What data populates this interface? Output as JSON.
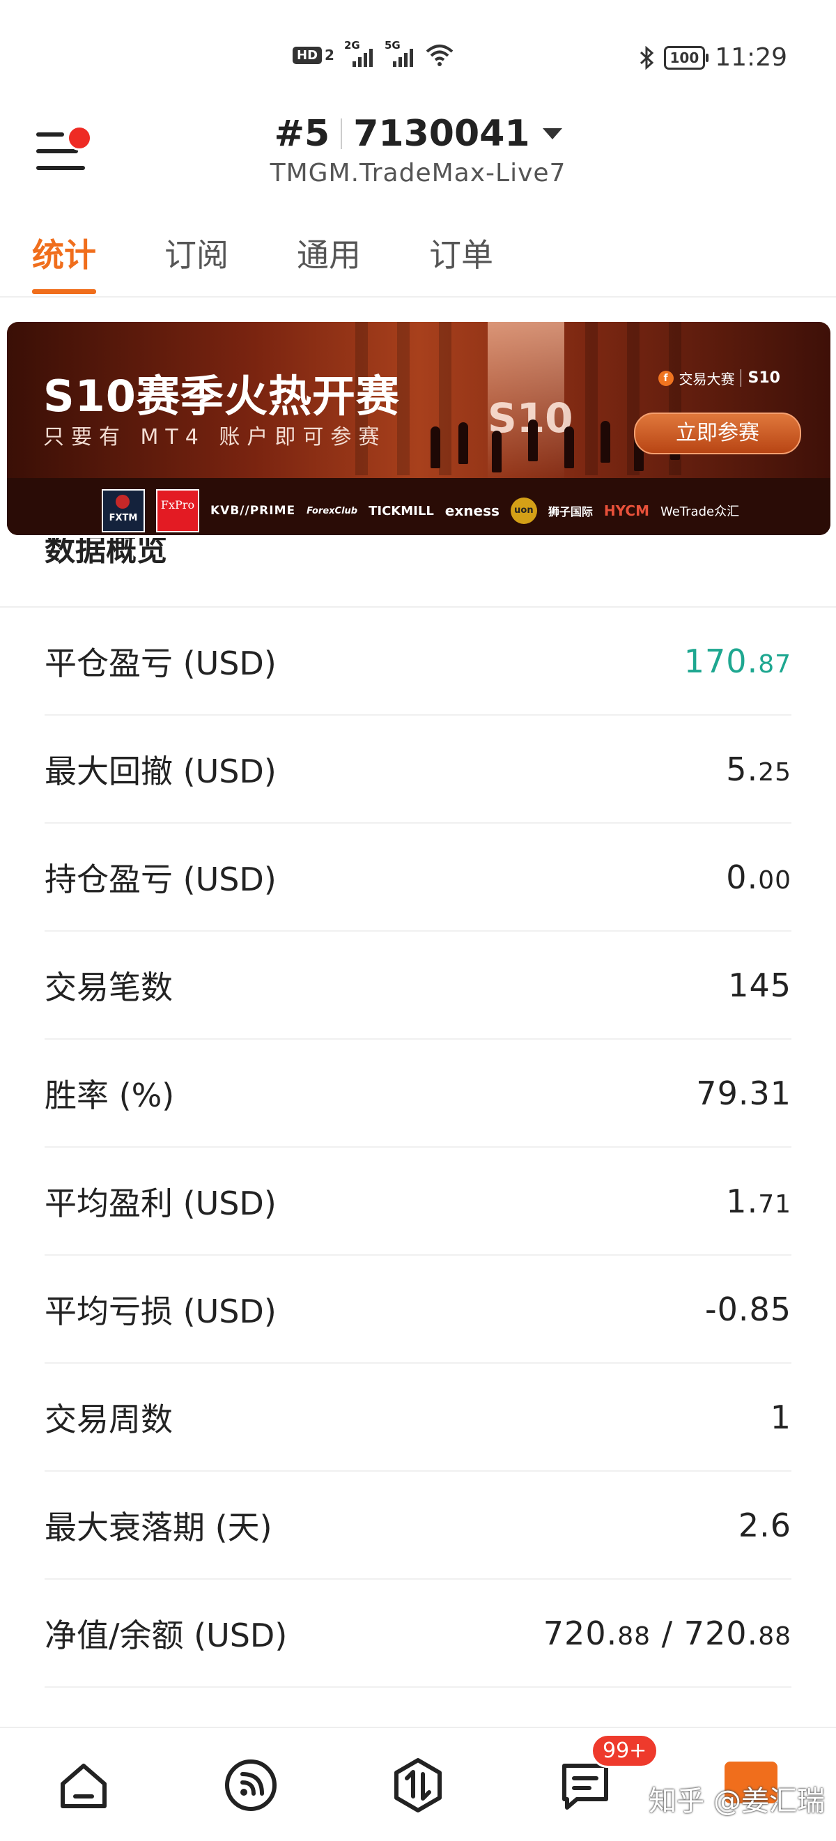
{
  "status_bar": {
    "hd_label": "HD",
    "hd_sim": "2",
    "net1": "2G",
    "net2": "5G",
    "battery": "100",
    "time": "11:29"
  },
  "header": {
    "account_prefix": "#5",
    "account_number": "7130041",
    "server": "TMGM.TradeMax-Live7"
  },
  "tabs": [
    "统计",
    "订阅",
    "通用",
    "订单"
  ],
  "banner": {
    "title": "S10赛季火热开赛",
    "subtitle": "只要有 MT4 账户即可参赛",
    "season_mark": "S10",
    "brand": "交易大赛",
    "brand_season": "S10",
    "button": "立即参赛",
    "sponsors": [
      "FXTM 富拓",
      "FxPro",
      "KVB//PRIME",
      "ForexClub",
      "TICKMILL",
      "exness",
      "狮子国际",
      "HYCM",
      "WeTrade众汇"
    ]
  },
  "section": {
    "title": "数据概览"
  },
  "stats": [
    {
      "label": "平仓盈亏 (USD)",
      "main": "170.",
      "dec": "87",
      "color": "#1ea790"
    },
    {
      "label": "最大回撤 (USD)",
      "main": "5.",
      "dec": "25"
    },
    {
      "label": "持仓盈亏 (USD)",
      "main": "0.",
      "dec": "00"
    },
    {
      "label": "交易笔数",
      "main": "145",
      "dec": ""
    },
    {
      "label": "胜率 (%)",
      "main": "79.31",
      "dec": ""
    },
    {
      "label": "平均盈利 (USD)",
      "main": "1.",
      "dec": "71"
    },
    {
      "label": "平均亏损 (USD)",
      "main": "-0.85",
      "dec": ""
    },
    {
      "label": "交易周数",
      "main": "1",
      "dec": ""
    },
    {
      "label": "最大衰落期 (天)",
      "main": "2.6",
      "dec": ""
    },
    {
      "label": "净值/余额 (USD)",
      "main": "720.",
      "dec": "88",
      "main2": " / 720.",
      "dec2": "88"
    }
  ],
  "bottom_nav": {
    "badge": "99+",
    "icons": [
      "home-icon",
      "feed-icon",
      "trade-icon",
      "message-icon",
      "profile-icon"
    ]
  },
  "watermark": "知乎 @姜汇瑞",
  "colors": {
    "accent": "#f06e1c",
    "profit": "#1ea790",
    "badge": "#ee3a2c"
  }
}
